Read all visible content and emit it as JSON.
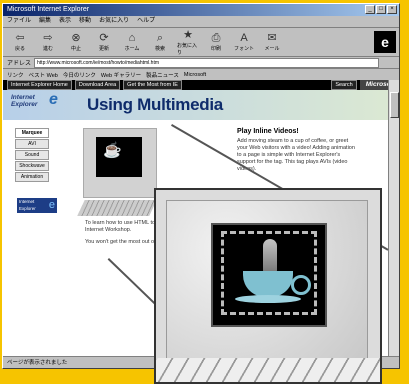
{
  "window": {
    "title": "Microsoft Internet Explorer",
    "controls": [
      "_",
      "□",
      "×"
    ]
  },
  "menu": [
    "ファイル",
    "編集",
    "表示",
    "移動",
    "お気に入り",
    "ヘルプ"
  ],
  "toolbar": {
    "buttons": [
      {
        "label": "戻る",
        "icon": "back-arrow-icon",
        "glyph": "⇦"
      },
      {
        "label": "進む",
        "icon": "forward-arrow-icon",
        "glyph": "⇨"
      },
      {
        "label": "中止",
        "icon": "stop-icon",
        "glyph": "⊗"
      },
      {
        "label": "更新",
        "icon": "refresh-icon",
        "glyph": "⟳"
      },
      {
        "label": "ホーム",
        "icon": "home-icon",
        "glyph": "⌂"
      },
      {
        "label": "検索",
        "icon": "search-icon",
        "glyph": "⌕"
      },
      {
        "label": "お気に入り",
        "icon": "favorites-icon",
        "glyph": "★"
      },
      {
        "label": "印刷",
        "icon": "print-icon",
        "glyph": "⎙"
      },
      {
        "label": "フォント",
        "icon": "font-icon",
        "glyph": "A"
      },
      {
        "label": "メール",
        "icon": "mail-icon",
        "glyph": "✉"
      }
    ],
    "logo": "e"
  },
  "address": {
    "label": "アドレス",
    "value": "http://www.microsoft.com/ie/most/howto/mediahtml.htm"
  },
  "links": [
    "リンク",
    "ベスト Web",
    "今日のリンク",
    "Web ギャラリー",
    "製品ニュース",
    "Microsoft"
  ],
  "navbar": {
    "items": [
      "Internet Explorer Home",
      "Download Area",
      "Get the Most from IE"
    ],
    "search": "Search",
    "brand": "Microsoft"
  },
  "header": {
    "brand_line1": "Internet",
    "brand_line2": "Explorer",
    "brand_glyph": "e",
    "title": "Using Multimedia"
  },
  "sidenav": [
    "Marquee",
    "AVI",
    "Sound",
    "Shockwave",
    "Animation"
  ],
  "ie_badge": {
    "line1": "Internet",
    "line2": "Explorer",
    "glyph": "e"
  },
  "right_col": {
    "title": "Play Inline Videos!",
    "body": "Add moving steam to a cup of coffee, or greet your Web visitors with a video! Adding animation to a page is simple with Internet Explorer's support for the tag. This tag plays AVIs (video videos)."
  },
  "bottom_text": [
    "To learn how to use HTML to add multimedia, see the Internet Workshop.",
    "You won't get the most out of this page..."
  ],
  "status": "ページが表示されました",
  "colors": {
    "background": "#f6c400",
    "title_text": "#0f2c6b",
    "titlebar": "#0a246a"
  }
}
